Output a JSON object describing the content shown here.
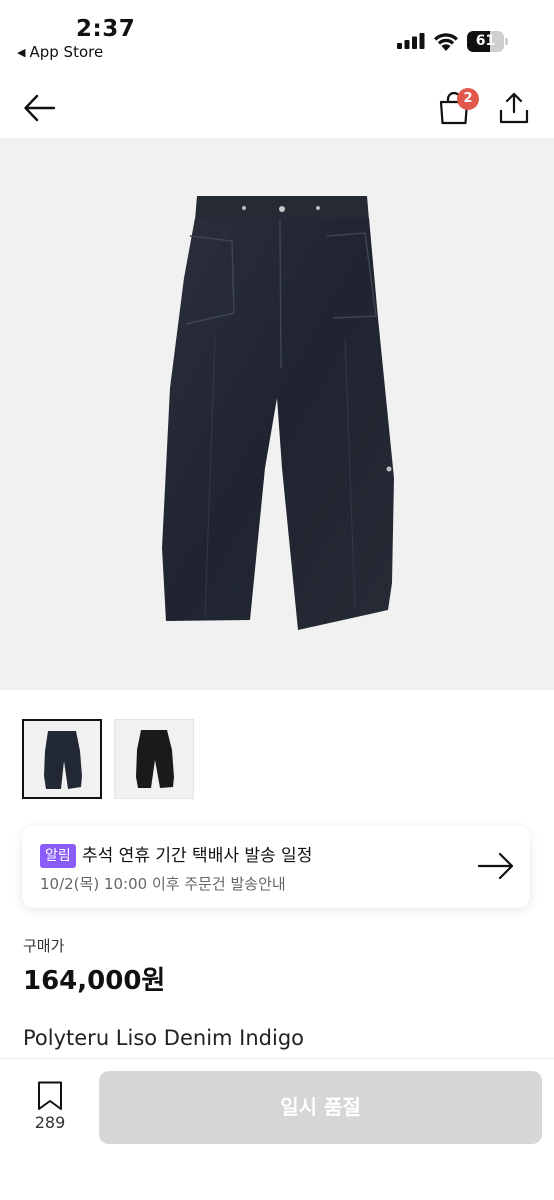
{
  "status_bar": {
    "time": "2:37",
    "back_app": "App Store",
    "battery_level": "61"
  },
  "nav": {
    "back_icon": "arrow-left-icon",
    "bag_icon": "shopping-bag-icon",
    "bag_count": "2",
    "share_icon": "share-icon",
    "badge_color": "#e2574c"
  },
  "gallery": {
    "thumbnail_count": 2,
    "selected_index": 0
  },
  "notice": {
    "badge": "알림",
    "title": "추석 연휴 기간 택배사 발송 일정",
    "subtitle": "10/2(목) 10:00 이후 주문건 발송안내",
    "arrow_icon": "arrow-right-icon",
    "badge_color": "#8a5cf6"
  },
  "product": {
    "price_label": "구매가",
    "price": "164,000원",
    "name": "Polyteru Liso Denim Indigo"
  },
  "bottom": {
    "bookmark_icon": "bookmark-icon",
    "bookmark_count": "289",
    "button_label": "일시 품절"
  }
}
